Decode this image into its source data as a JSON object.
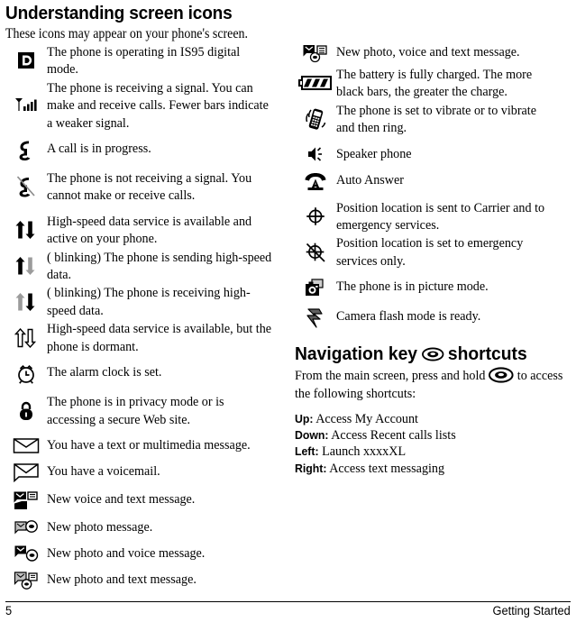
{
  "section": {
    "title": "Understanding screen icons",
    "intro": "These icons may appear on your phone's screen."
  },
  "left_column": [
    {
      "icon": "digital-mode-d-icon",
      "text": "The phone is operating in IS95 digital mode."
    },
    {
      "icon": "signal-bars-icon",
      "text": "The phone is receiving a signal. You can make and receive calls. Fewer bars indicate a weaker signal."
    },
    {
      "icon": "call-in-progress-icon",
      "text": "A call is in progress."
    },
    {
      "icon": "no-signal-icon",
      "text": "The phone is not receiving a signal. You cannot make or receive calls."
    },
    {
      "icon": "data-active-icon",
      "text": "High-speed data service is available and active on your phone."
    },
    {
      "icon": "data-sending-icon",
      "text": "( blinking)  The phone is sending high-speed data."
    },
    {
      "icon": "data-receiving-icon",
      "text": "( blinking)  The phone is receiving high-speed data."
    },
    {
      "icon": "data-dormant-icon",
      "text": "High-speed data service is available, but the phone is dormant."
    },
    {
      "icon": "alarm-clock-icon",
      "text": "The alarm clock is set."
    },
    {
      "icon": "padlock-icon",
      "text": "The phone is in privacy mode or is accessing a secure Web site."
    },
    {
      "icon": "envelope-icon",
      "text": "You have a text or multimedia message."
    },
    {
      "icon": "voicemail-envelope-icon",
      "text": "You have a voicemail."
    },
    {
      "icon": "voice-text-message-icon",
      "text": "New voice and text message."
    },
    {
      "icon": "photo-message-icon",
      "text": "New photo message."
    },
    {
      "icon": "photo-voice-message-icon",
      "text": "New photo and voice message."
    },
    {
      "icon": "photo-text-message-icon",
      "text": "New photo and text message."
    }
  ],
  "right_column": [
    {
      "icon": "photo-voice-text-message-icon",
      "text": "New photo, voice and text message."
    },
    {
      "icon": "battery-full-icon",
      "text": "The battery is fully charged. The more black bars, the greater the charge."
    },
    {
      "icon": "vibrate-icon",
      "text": "The phone is set to vibrate or to vibrate and then ring."
    },
    {
      "icon": "speaker-phone-icon",
      "text": "Speaker phone"
    },
    {
      "icon": "auto-answer-icon",
      "text": "Auto Answer"
    },
    {
      "icon": "location-on-icon",
      "text": "Position location is sent to Carrier and to emergency services."
    },
    {
      "icon": "location-emergency-only-icon",
      "text": "Position location is set to emergency services only."
    },
    {
      "icon": "picture-mode-icon",
      "text": "The phone is in picture mode."
    },
    {
      "icon": "camera-flash-icon",
      "text": "Camera flash mode is ready."
    }
  ],
  "navigation": {
    "title_before": "Navigation key",
    "title_after": "shortcuts",
    "key_icon": "navigation-key-icon",
    "intro_before": "From the main screen, press and hold",
    "intro_after": "to access the following shortcuts:",
    "shortcuts": [
      {
        "key": "Up:",
        "action": "Access My Account"
      },
      {
        "key": "Down:",
        "action": "Access Recent calls lists"
      },
      {
        "key": "Left:",
        "action": "Launch xxxxXL"
      },
      {
        "key": "Right:",
        "action": "Access text messaging"
      }
    ]
  },
  "footer": {
    "page_number": "5",
    "chapter": "Getting Started"
  },
  "colors": {
    "text": "#000000",
    "background": "#ffffff",
    "icon_gray": "#9b9b9b"
  }
}
